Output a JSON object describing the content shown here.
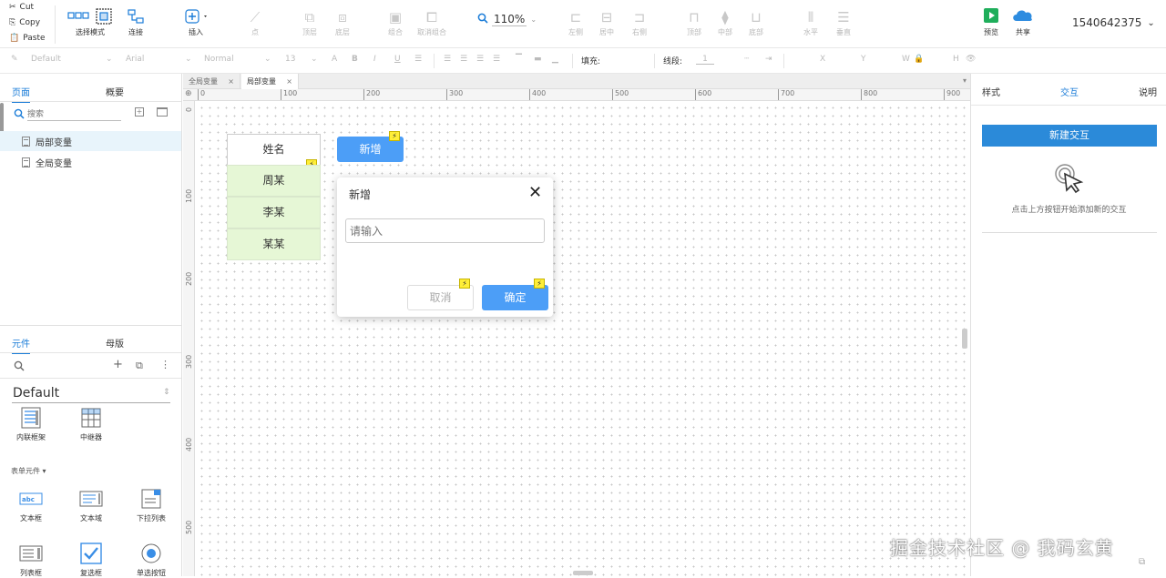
{
  "clipboard": {
    "cut": "Cut",
    "copy": "Copy",
    "paste": "Paste"
  },
  "toolbar": {
    "select_mode": "选择模式",
    "connect": "连接",
    "insert": "插入",
    "point": "点",
    "top_layer": "顶层",
    "bottom_layer": "底层",
    "group": "组合",
    "ungroup": "取消组合",
    "zoom": "110%",
    "align_left": "左侧",
    "align_center": "居中",
    "align_right": "右侧",
    "align_top": "顶部",
    "align_middle": "中部",
    "align_bottom": "底部",
    "distribute_h": "水平",
    "distribute_v": "垂直",
    "preview": "预览",
    "share": "共享",
    "account": "1540642375"
  },
  "formatbar": {
    "style": "Default",
    "font": "Arial",
    "weight": "Normal",
    "size": "13",
    "fill_label": "填充:",
    "line_label": "线段:",
    "line_value": "1",
    "x_label": "X",
    "y_label": "Y",
    "w_label": "W",
    "h_label": "H"
  },
  "left": {
    "tab_pages": "页面",
    "tab_outline": "概要",
    "search_placeholder": "搜索",
    "pages": [
      "局部变量",
      "全局变量"
    ],
    "tab_widgets": "元件",
    "tab_masters": "母版",
    "library": "Default",
    "widgets_top": [
      "内联框架",
      "中继器"
    ],
    "section_label": "表单元件 ▾",
    "form_widgets": [
      "文本框",
      "文本域",
      "下拉列表",
      "列表框",
      "复选框",
      "单选按钮"
    ]
  },
  "doc_tabs": [
    "全局变量",
    "局部变量"
  ],
  "ruler": {
    "h": [
      "0",
      "100",
      "200",
      "300",
      "400",
      "500",
      "600",
      "700",
      "800",
      "900"
    ],
    "v": [
      "0",
      "100",
      "200",
      "300",
      "400",
      "500"
    ]
  },
  "canvas": {
    "table_header": "姓名",
    "rows": [
      "周某",
      "李某",
      "某某"
    ],
    "add_button": "新增",
    "dialog": {
      "title": "新增",
      "input_placeholder": "请输入",
      "cancel": "取消",
      "confirm": "确定"
    }
  },
  "right": {
    "tab_style": "样式",
    "tab_interaction": "交互",
    "tab_notes": "说明",
    "new_interaction": "新建交互",
    "hint": "点击上方按钮开始添加新的交互"
  },
  "watermark": "掘金技术社区 @ 我码玄黄",
  "colors": {
    "accent": "#1a7cd8",
    "cell_fill": "#e6f7d6",
    "button_blue": "#4c9ef7",
    "bolt": "#ffee38"
  }
}
